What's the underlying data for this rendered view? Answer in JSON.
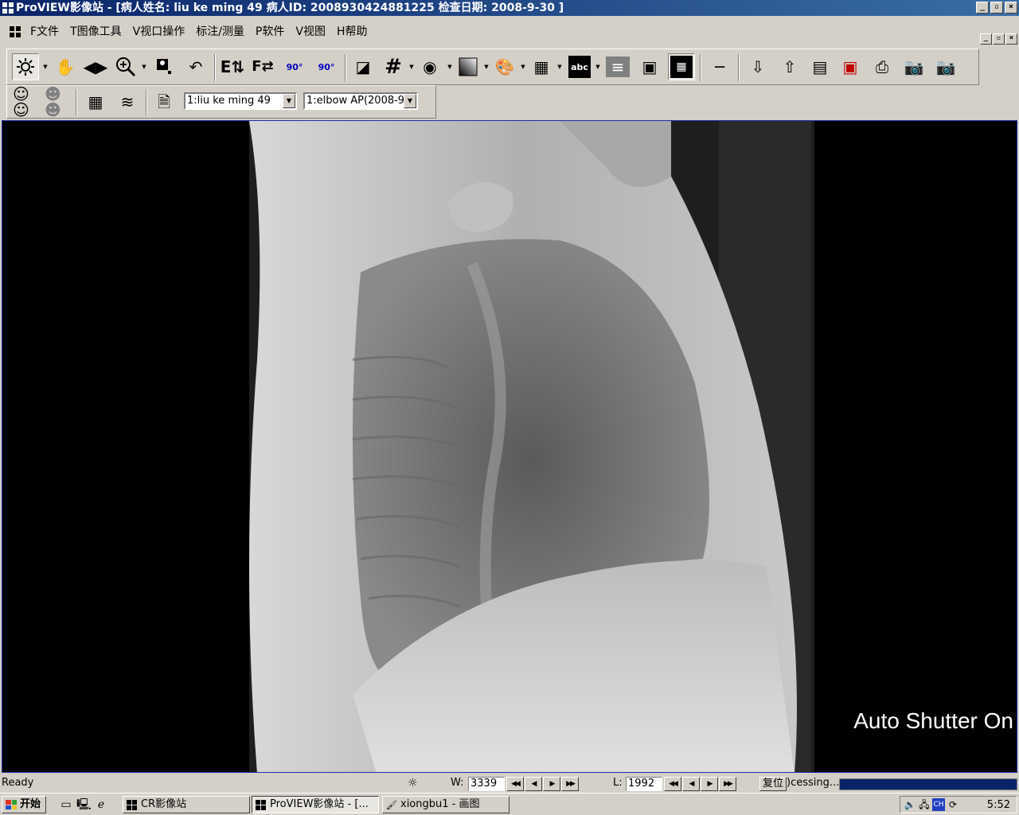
{
  "window": {
    "title": "ProVIEW影像站 - [病人姓名: liu ke ming 49 病人ID: 2008930424881225 检查日期: 2008-9-30 ]",
    "buttons": {
      "minimize": "_",
      "restore": "▫",
      "close": "×"
    }
  },
  "menubar": {
    "items": [
      "F文件",
      "T图像工具",
      "V视口操作",
      "标注/测量",
      "P软件",
      "V视图",
      "H帮助"
    ]
  },
  "toolbar1": {
    "tools": [
      "window-level",
      "pan",
      "flip-horizontal",
      "zoom",
      "magnify",
      "rotate",
      "flip-vertical",
      "flip-text",
      "rotate-left-90",
      "rotate-right-90",
      "invert",
      "grid",
      "shutter",
      "gradient",
      "palette",
      "layout",
      "annotation-text",
      "histogram",
      "portrait",
      "compare",
      "measure",
      "save",
      "export",
      "report",
      "print-dicom",
      "print",
      "camera",
      "camera-layout"
    ],
    "rotate_left_label": "90",
    "rotate_right_label": "90",
    "abc_label": "abc"
  },
  "toolbar2": {
    "patient_combo": "1:liu ke ming 49",
    "series_combo": "1:elbow AP(2008-9-"
  },
  "viewer": {
    "overlay_text": "Auto Shutter On"
  },
  "statusbar": {
    "ready": "Ready",
    "window_label": "W:",
    "window_value": "3339",
    "level_label": "L:",
    "level_value": "1992",
    "reset_button": "复位",
    "processing_text": ")cessing..."
  },
  "taskbar": {
    "start_label": "开始",
    "tasks": [
      "CR影像站",
      "ProVIEW影像站 - [...",
      "xiongbu1 - 画图"
    ],
    "clock": "5:52"
  },
  "colors": {
    "title_start": "#0a246a",
    "title_end": "#3a6ea5",
    "progress": "#0a246a",
    "viewer_border": "#2030a0"
  }
}
